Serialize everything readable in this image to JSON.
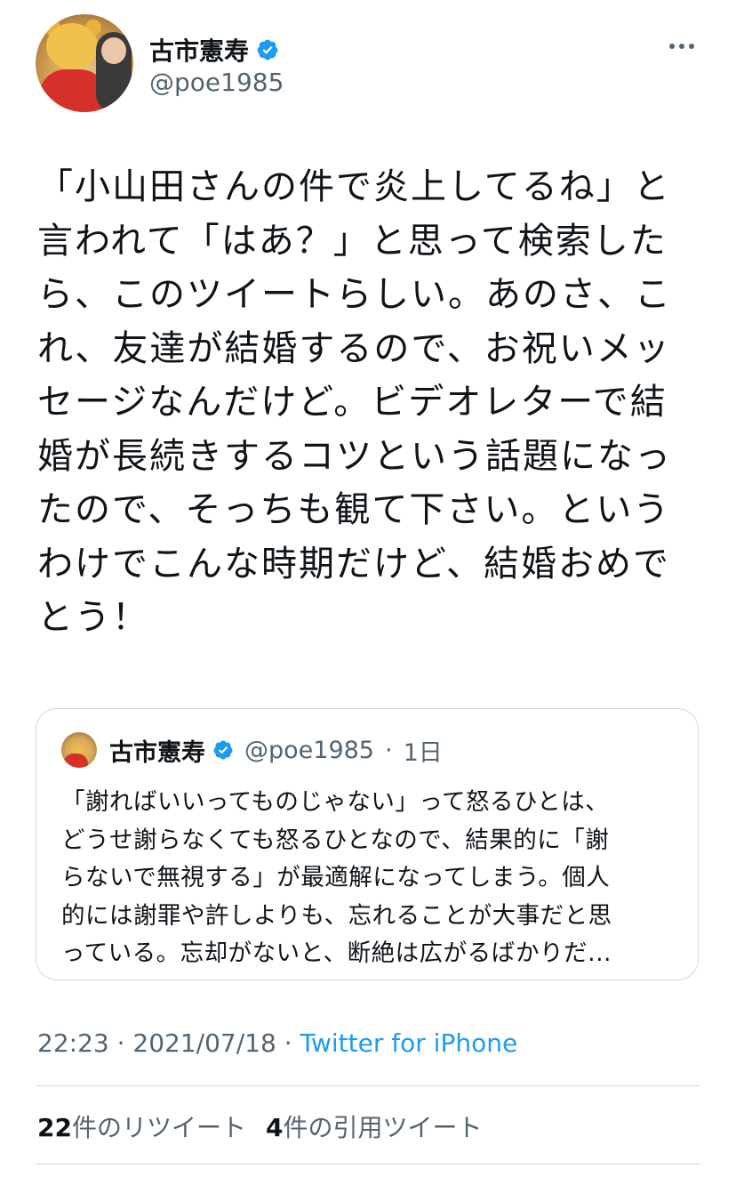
{
  "author": {
    "display_name": "古市憲寿",
    "handle": "@poe1985",
    "verified": true
  },
  "tweet": {
    "text": "「小山田さんの件で炎上してるね」と\n言われて「はあ？」と思って検索した\nら、このツイートらしい。あのさ、こ\nれ、友達が結婚するので、お祝いメッ\nセージなんだけど。ビデオレターで結\n婚が長続きするコツという話題になっ\nたので、そっちも観て下さい。という\nわけでこんな時期だけど、結婚おめで\nとう！",
    "time": "22:23",
    "date": "2021/07/18",
    "source": "Twitter for iPhone",
    "separator": "·"
  },
  "quoted_tweet": {
    "display_name": "古市憲寿",
    "handle": "@poe1985",
    "age": "1日",
    "separator": "·",
    "text": "「謝ればいいってものじゃない」って怒るひとは、\nどうせ謝らなくても怒るひとなので、結果的に「謝\nらないで無視する」が最適解になってしまう。個人\n的には謝罪や許しよりも、忘れることが大事だと思\nっている。忘却がないと、断絶は広がるばかりだ..."
  },
  "stats": {
    "retweets_count": "22",
    "retweets_label": "件のリツイート",
    "quotes_count": "4",
    "quotes_label": "件の引用ツイート"
  },
  "icons": {
    "verified": "verified-badge-icon",
    "more": "more-options-icon"
  },
  "colors": {
    "accent": "#1d9bf0",
    "secondary_text": "#536471",
    "border": "#cfd9de"
  }
}
